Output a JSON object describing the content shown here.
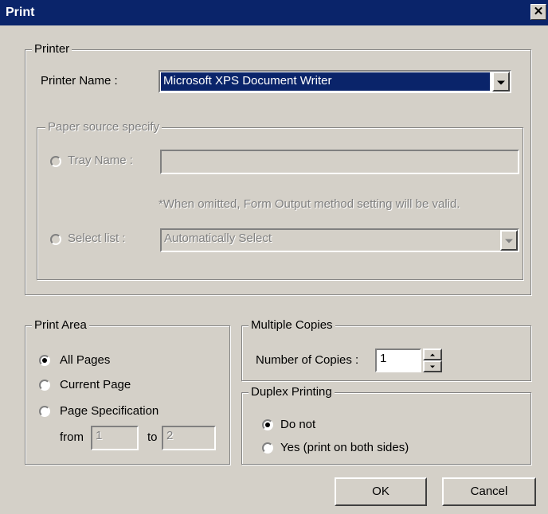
{
  "window": {
    "title": "Print",
    "close_glyph": "✕"
  },
  "printer": {
    "group_title": "Printer",
    "name_label": "Printer Name :",
    "name_value": "Microsoft XPS Document Writer",
    "paper_source": {
      "group_title": "Paper source specify",
      "tray_label": "Tray Name :",
      "tray_value": "",
      "note": "*When omitted, Form Output method setting will be valid.",
      "select_list_label": "Select list :",
      "select_list_value": "Automatically Select"
    }
  },
  "print_area": {
    "group_title": "Print Area",
    "options": [
      "All Pages",
      "Current Page",
      "Page Specification"
    ],
    "selected": "All Pages",
    "from_label": "from",
    "from_value": "1",
    "to_label": "to",
    "to_value": "2"
  },
  "copies": {
    "group_title": "Multiple Copies",
    "label": "Number of Copies :",
    "value": "1"
  },
  "duplex": {
    "group_title": "Duplex Printing",
    "options": [
      "Do not",
      "Yes (print on both sides)"
    ],
    "selected": "Do not"
  },
  "buttons": {
    "ok": "OK",
    "cancel": "Cancel"
  },
  "colors": {
    "titlebar": "#0a246a",
    "dialog": "#d4d0c8",
    "disabled_text": "#808080"
  },
  "icons": {
    "close": "close-icon",
    "dropdown": "chevron-down-icon",
    "spin_up": "chevron-up-icon",
    "spin_down": "chevron-down-icon"
  }
}
